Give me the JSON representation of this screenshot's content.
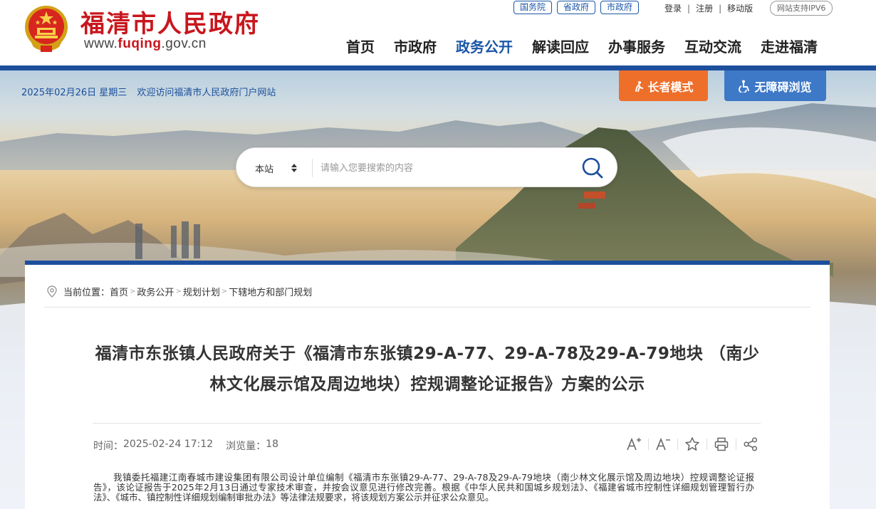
{
  "header": {
    "site_name": "福清市人民政府",
    "domain_prefix": "www.",
    "domain_accent": "fuqing",
    "domain_suffix": ".gov.cn",
    "gov_links": [
      "国务院",
      "省政府",
      "市政府"
    ],
    "user_links": {
      "login": "登录",
      "register": "注册",
      "mobile": "移动版"
    },
    "ipv6_badge": "网站支持IPV6",
    "nav": [
      "首页",
      "市政府",
      "政务公开",
      "解读回应",
      "办事服务",
      "互动交流",
      "走进福清"
    ],
    "active_nav": "政务公开"
  },
  "banner": {
    "date": "2025年02月26日 星期三",
    "welcome": "欢迎访问福清市人民政府门户网站",
    "elder_mode": "长者模式",
    "accessible": "无障碍浏览",
    "search": {
      "scope": "本站",
      "placeholder": "请输入您要搜索的内容",
      "icon": "search-icon"
    }
  },
  "breadcrumb": {
    "label": "当前位置：",
    "items": [
      "首页",
      "政务公开",
      "规划计划",
      "下辖地方和部门规划"
    ]
  },
  "article": {
    "title": "福清市东张镇人民政府关于《福清市东张镇29-A-77、29-A-78及29-A-79地块 （南少林文化展示馆及周边地块）控规调整论证报告》方案的公示",
    "time_label": "时间：",
    "time": "2025-02-24 17:12",
    "views_label": "浏览量：",
    "views": "18",
    "body": "我镇委托福建江南春城市建设集团有限公司设计单位编制《福清市东张镇29-A-77、29-A-78及29-A-79地块（南少林文化展示馆及周边地块）控规调整论证报告》，该论证报告于2025年2月13日通过专家技术审查，并按会议意见进行修改完善。根据《中华人民共和国城乡规划法》、《福建省城市控制性详细规划管理暂行办法》、《城市、镇控制性详细规划编制审批办法》等法律法规要求，将该规划方案公示并征求公众意见。"
  },
  "tools": [
    "font-increase-icon",
    "font-decrease-icon",
    "star-icon",
    "print-icon",
    "share-icon"
  ],
  "colors": {
    "brand_red": "#c8161d",
    "brand_blue": "#1d4f9c",
    "elder_orange": "#ee6f2a",
    "access_blue": "#3e79c8"
  }
}
